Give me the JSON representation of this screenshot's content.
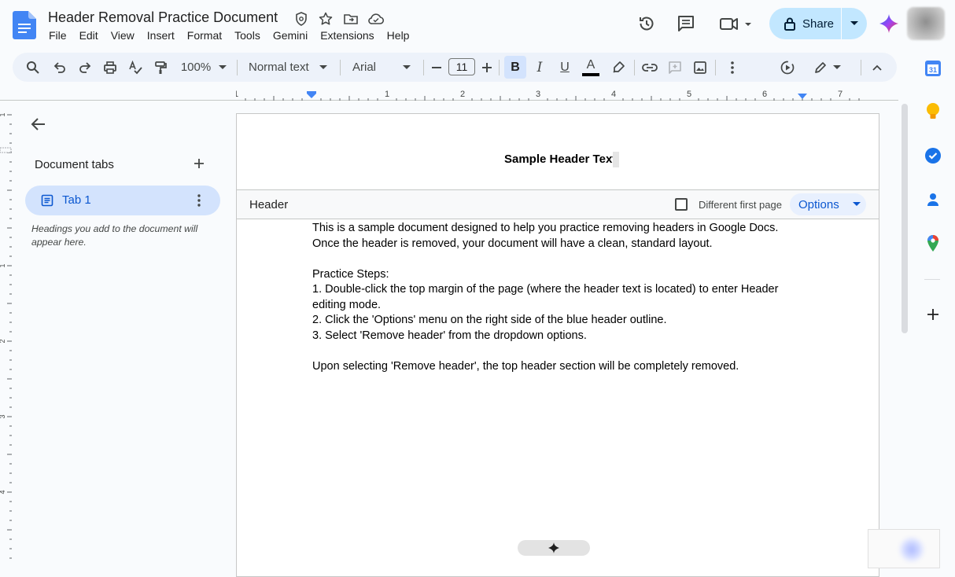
{
  "document": {
    "title": "Header Removal Practice Document"
  },
  "menu": [
    "File",
    "Edit",
    "View",
    "Insert",
    "Format",
    "Tools",
    "Gemini",
    "Extensions",
    "Help"
  ],
  "share": {
    "label": "Share"
  },
  "toolbar": {
    "zoom": "100%",
    "style": "Normal text",
    "font": "Arial",
    "font_size": "11",
    "bold": "B",
    "italic": "I",
    "underline": "U",
    "text_color": "A"
  },
  "ruler": {
    "marks": [
      "1",
      "1",
      "2",
      "3",
      "4",
      "5",
      "6",
      "7"
    ]
  },
  "vruler": {
    "marks": [
      "1",
      "1",
      "2",
      "3",
      "4"
    ]
  },
  "outline": {
    "heading": "Document tabs",
    "tab_label": "Tab 1",
    "hint": "Headings you add to the document will appear here."
  },
  "page": {
    "header_text": "Sample Header Text",
    "header_label": "Header",
    "different_first_page": "Different first page",
    "options_label": "Options",
    "body": [
      "This is a sample document designed to help you practice removing headers in Google Docs.",
      "Once the header is removed, your document will have a clean, standard layout.",
      "",
      "Practice Steps:",
      "1. Double-click the top margin of the page (where the header text is located) to enter Header editing mode.",
      "2. Click the 'Options' menu on the right side of the blue header outline.",
      "3. Select 'Remove header' from the dropdown options.",
      "",
      "Upon selecting 'Remove header', the top header section will be completely removed."
    ]
  },
  "colors": {
    "accent": "#0b57d0",
    "share_bg": "#c2e7ff",
    "toolbar_bg": "#edf2fa",
    "tab_active_bg": "#d3e3fd"
  },
  "icons": {
    "title_bar": [
      "status-shield-icon",
      "star-icon",
      "move-folder-icon",
      "cloud-saved-icon"
    ],
    "top": [
      "version-history-icon",
      "comments-icon",
      "meet-icon",
      "lock-icon",
      "gemini-icon"
    ],
    "side_panel": [
      "calendar-icon",
      "keep-icon",
      "tasks-icon",
      "contacts-icon",
      "maps-icon",
      "add-addon-icon"
    ]
  }
}
